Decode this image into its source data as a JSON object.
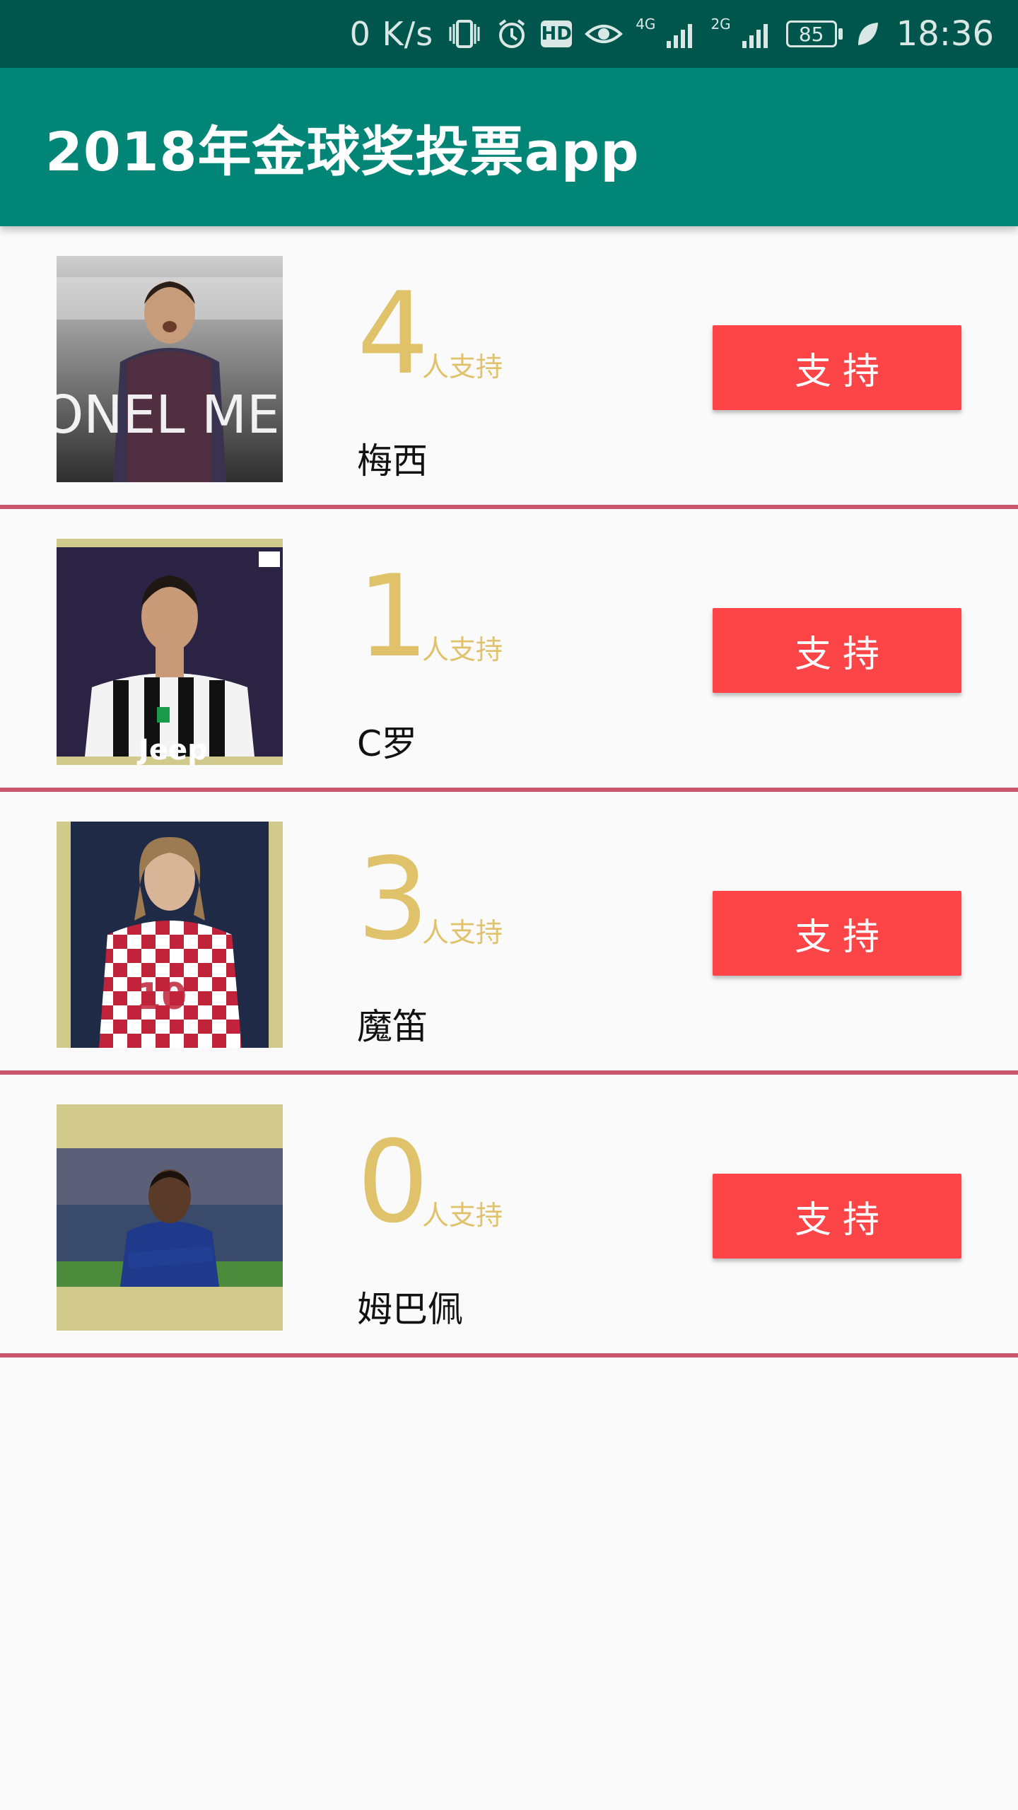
{
  "status_bar": {
    "network_speed": "0 K/s",
    "hd_badge": "HD",
    "signal_4g_label": "4G",
    "signal_2g_label": "2G",
    "battery_level": "85",
    "time": "18:36"
  },
  "app_bar": {
    "title": "2018年金球奖投票app"
  },
  "players": [
    {
      "name": "梅西",
      "votes": "4",
      "support_label": "人支持",
      "button_label": "支持",
      "photo_caption": "ONEL ME",
      "photo_icon": "messi-photo"
    },
    {
      "name": "C罗",
      "votes": "1",
      "support_label": "人支持",
      "button_label": "支持",
      "photo_caption": "Jeep",
      "photo_icon": "ronaldo-photo"
    },
    {
      "name": "魔笛",
      "votes": "3",
      "support_label": "人支持",
      "button_label": "支持",
      "photo_caption": "10",
      "photo_icon": "modric-photo"
    },
    {
      "name": "姆巴佩",
      "votes": "0",
      "support_label": "人支持",
      "button_label": "支持",
      "photo_caption": "",
      "photo_icon": "mbappe-photo"
    }
  ],
  "colors": {
    "status_bar": "#00564d",
    "app_bar": "#008577",
    "vote_count": "#dfc26a",
    "button": "#fd4548",
    "divider": "#c9566e"
  }
}
